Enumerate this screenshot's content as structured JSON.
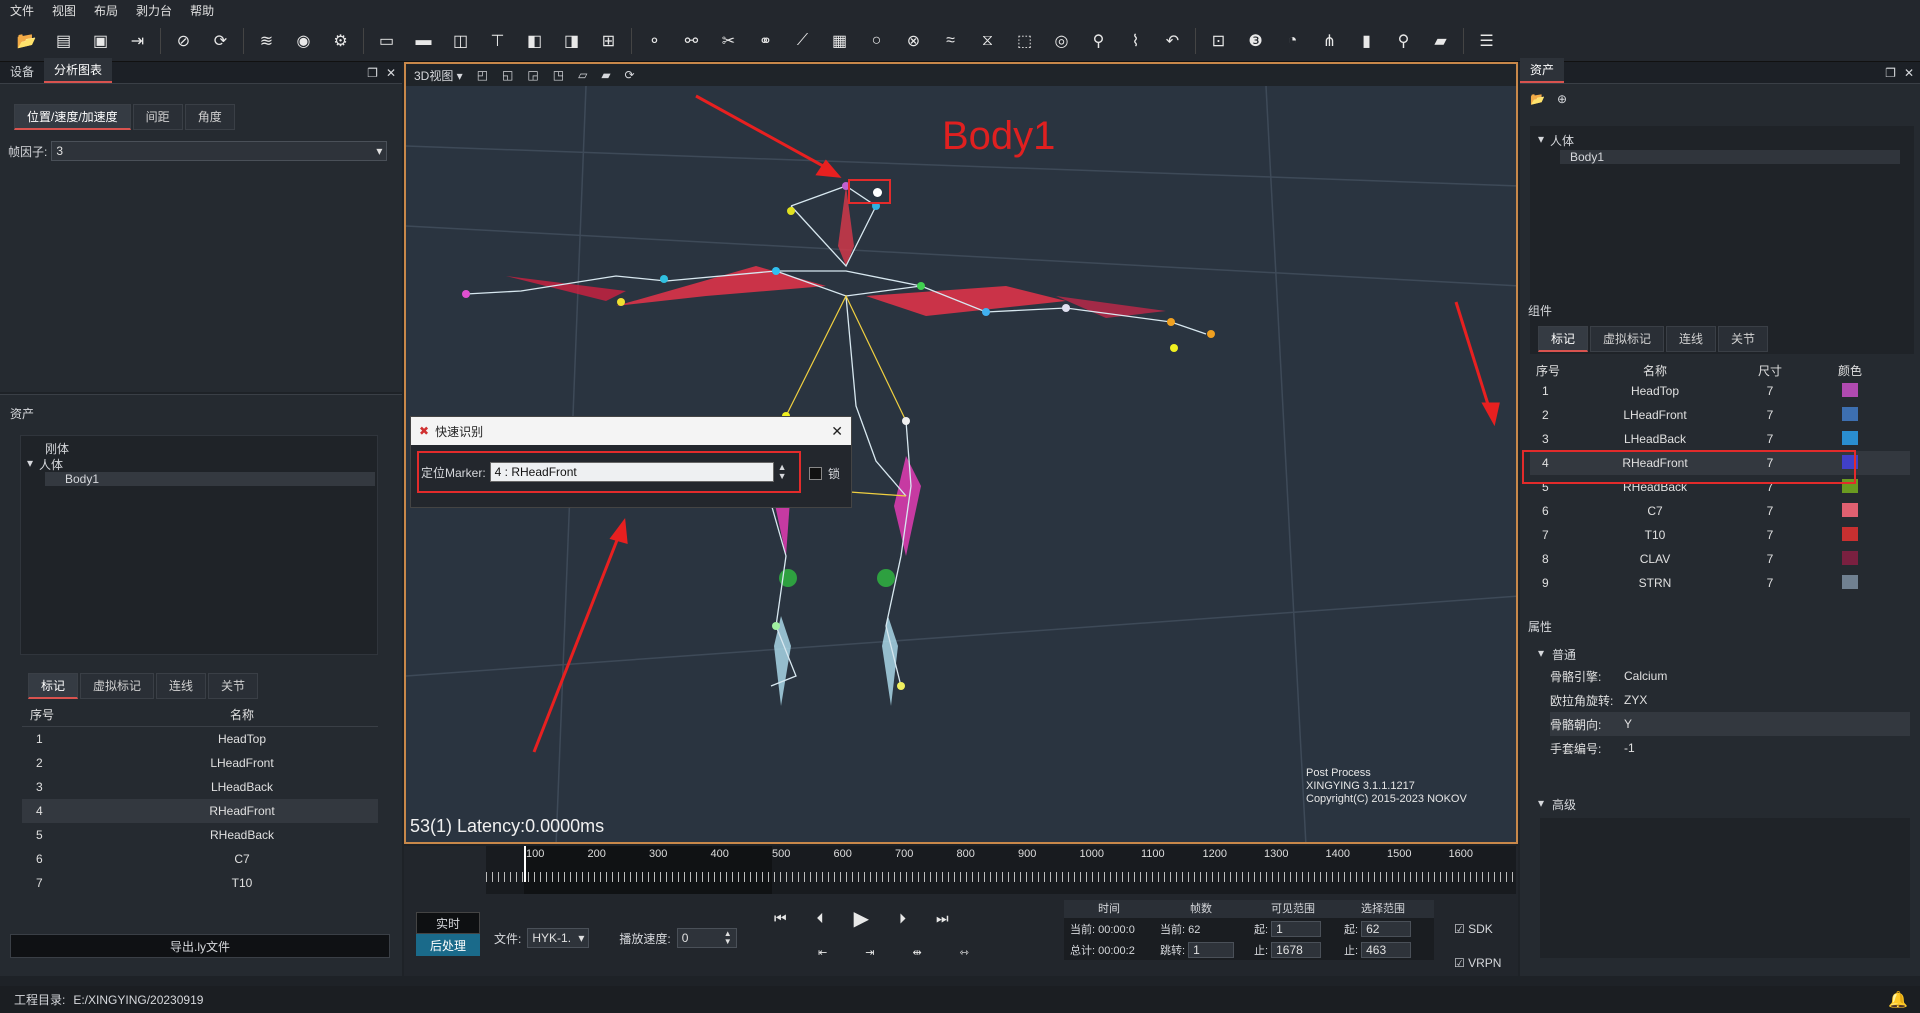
{
  "menu": [
    "文件",
    "视图",
    "布局",
    "剥力台",
    "帮助"
  ],
  "left_top": {
    "tabs": [
      "设备",
      "分析图表"
    ],
    "active_tab": 1,
    "subtabs": [
      "位置/速度/加速度",
      "间距",
      "角度"
    ],
    "frame_factor_label": "帧因子:",
    "frame_factor_value": "3"
  },
  "left_assets": {
    "title": "资产",
    "tree": {
      "rigid": "刚体",
      "human": "人体",
      "body": "Body1"
    },
    "tabs": [
      "标记",
      "虚拟标记",
      "连线",
      "关节"
    ],
    "col_index": "序号",
    "col_name": "名称",
    "rows": [
      [
        "1",
        "HeadTop"
      ],
      [
        "2",
        "LHeadFront"
      ],
      [
        "3",
        "LHeadBack"
      ],
      [
        "4",
        "RHeadFront"
      ],
      [
        "5",
        "RHeadBack"
      ],
      [
        "6",
        "C7"
      ],
      [
        "7",
        "T10"
      ]
    ],
    "export_button": "导出.ly文件"
  },
  "viewport": {
    "view_label": "3D视图",
    "body_label": "Body1",
    "latency": "53(1) Latency:0.0000ms",
    "footer": [
      "Post Process",
      "XINGYING 3.1.1.1217",
      "Copyright(C) 2015-2023 NOKOV"
    ]
  },
  "dialog": {
    "title": "快速识别",
    "marker_label": "定位Marker:",
    "marker_value": "4 : RHeadFront",
    "lock_label": "锁"
  },
  "timeline": {
    "ticks": [
      "100",
      "200",
      "300",
      "400",
      "500",
      "600",
      "700",
      "800",
      "900",
      "1000",
      "1100",
      "1200",
      "1300",
      "1400",
      "1500",
      "1600"
    ],
    "mode_realtime": "实时",
    "mode_post": "后处理",
    "file_label": "文件:",
    "file_value": "HYK-1.",
    "speed_label": "播放速度:",
    "speed_value": "0",
    "time_header": "时间",
    "frame_header": "帧数",
    "visible_header": "可见范围",
    "select_header": "选择范围",
    "current_label": "当前:",
    "current_time": "00:00:0",
    "total_label": "总计:",
    "total_time": "00:00:2",
    "frame_current_label": "当前:",
    "frame_current": "62",
    "jump_label": "跳转:",
    "jump_value": "1",
    "vis_start_label": "起:",
    "vis_start": "1",
    "vis_end_label": "止:",
    "vis_end": "1678",
    "sel_start_label": "起:",
    "sel_start": "62",
    "sel_end_label": "止:",
    "sel_end": "463",
    "sdk": "SDK",
    "vrpn": "VRPN"
  },
  "right": {
    "title": "资产",
    "tree": {
      "human": "人体",
      "body": "Body1"
    },
    "components_title": "组件",
    "tabs": [
      "标记",
      "虚拟标记",
      "连线",
      "关节"
    ],
    "cols": [
      "序号",
      "名称",
      "尺寸",
      "颜色"
    ],
    "rows": [
      [
        "1",
        "HeadTop",
        "7",
        "#b04ab0"
      ],
      [
        "2",
        "LHeadFront",
        "7",
        "#3d6fb0"
      ],
      [
        "3",
        "LHeadBack",
        "7",
        "#2a8ed0"
      ],
      [
        "4",
        "RHeadFront",
        "7",
        "#4040c8"
      ],
      [
        "5",
        "RHeadBack",
        "7",
        "#6a9a20"
      ],
      [
        "6",
        "C7",
        "7",
        "#e06070"
      ],
      [
        "7",
        "T10",
        "7",
        "#c83030"
      ],
      [
        "8",
        "CLAV",
        "7",
        "#7a2040"
      ],
      [
        "9",
        "STRN",
        "7",
        "#708090"
      ]
    ],
    "props_title": "属性",
    "general": "普通",
    "props": [
      [
        "骨骼引擎:",
        "Calcium"
      ],
      [
        "欧拉角旋转:",
        "ZYX"
      ],
      [
        "骨骼朝向:",
        "Y"
      ],
      [
        "手套编号:",
        "-1"
      ]
    ],
    "advanced": "高级"
  },
  "status": {
    "label": "工程目录:",
    "path": "E:/XINGYING/20230919"
  }
}
